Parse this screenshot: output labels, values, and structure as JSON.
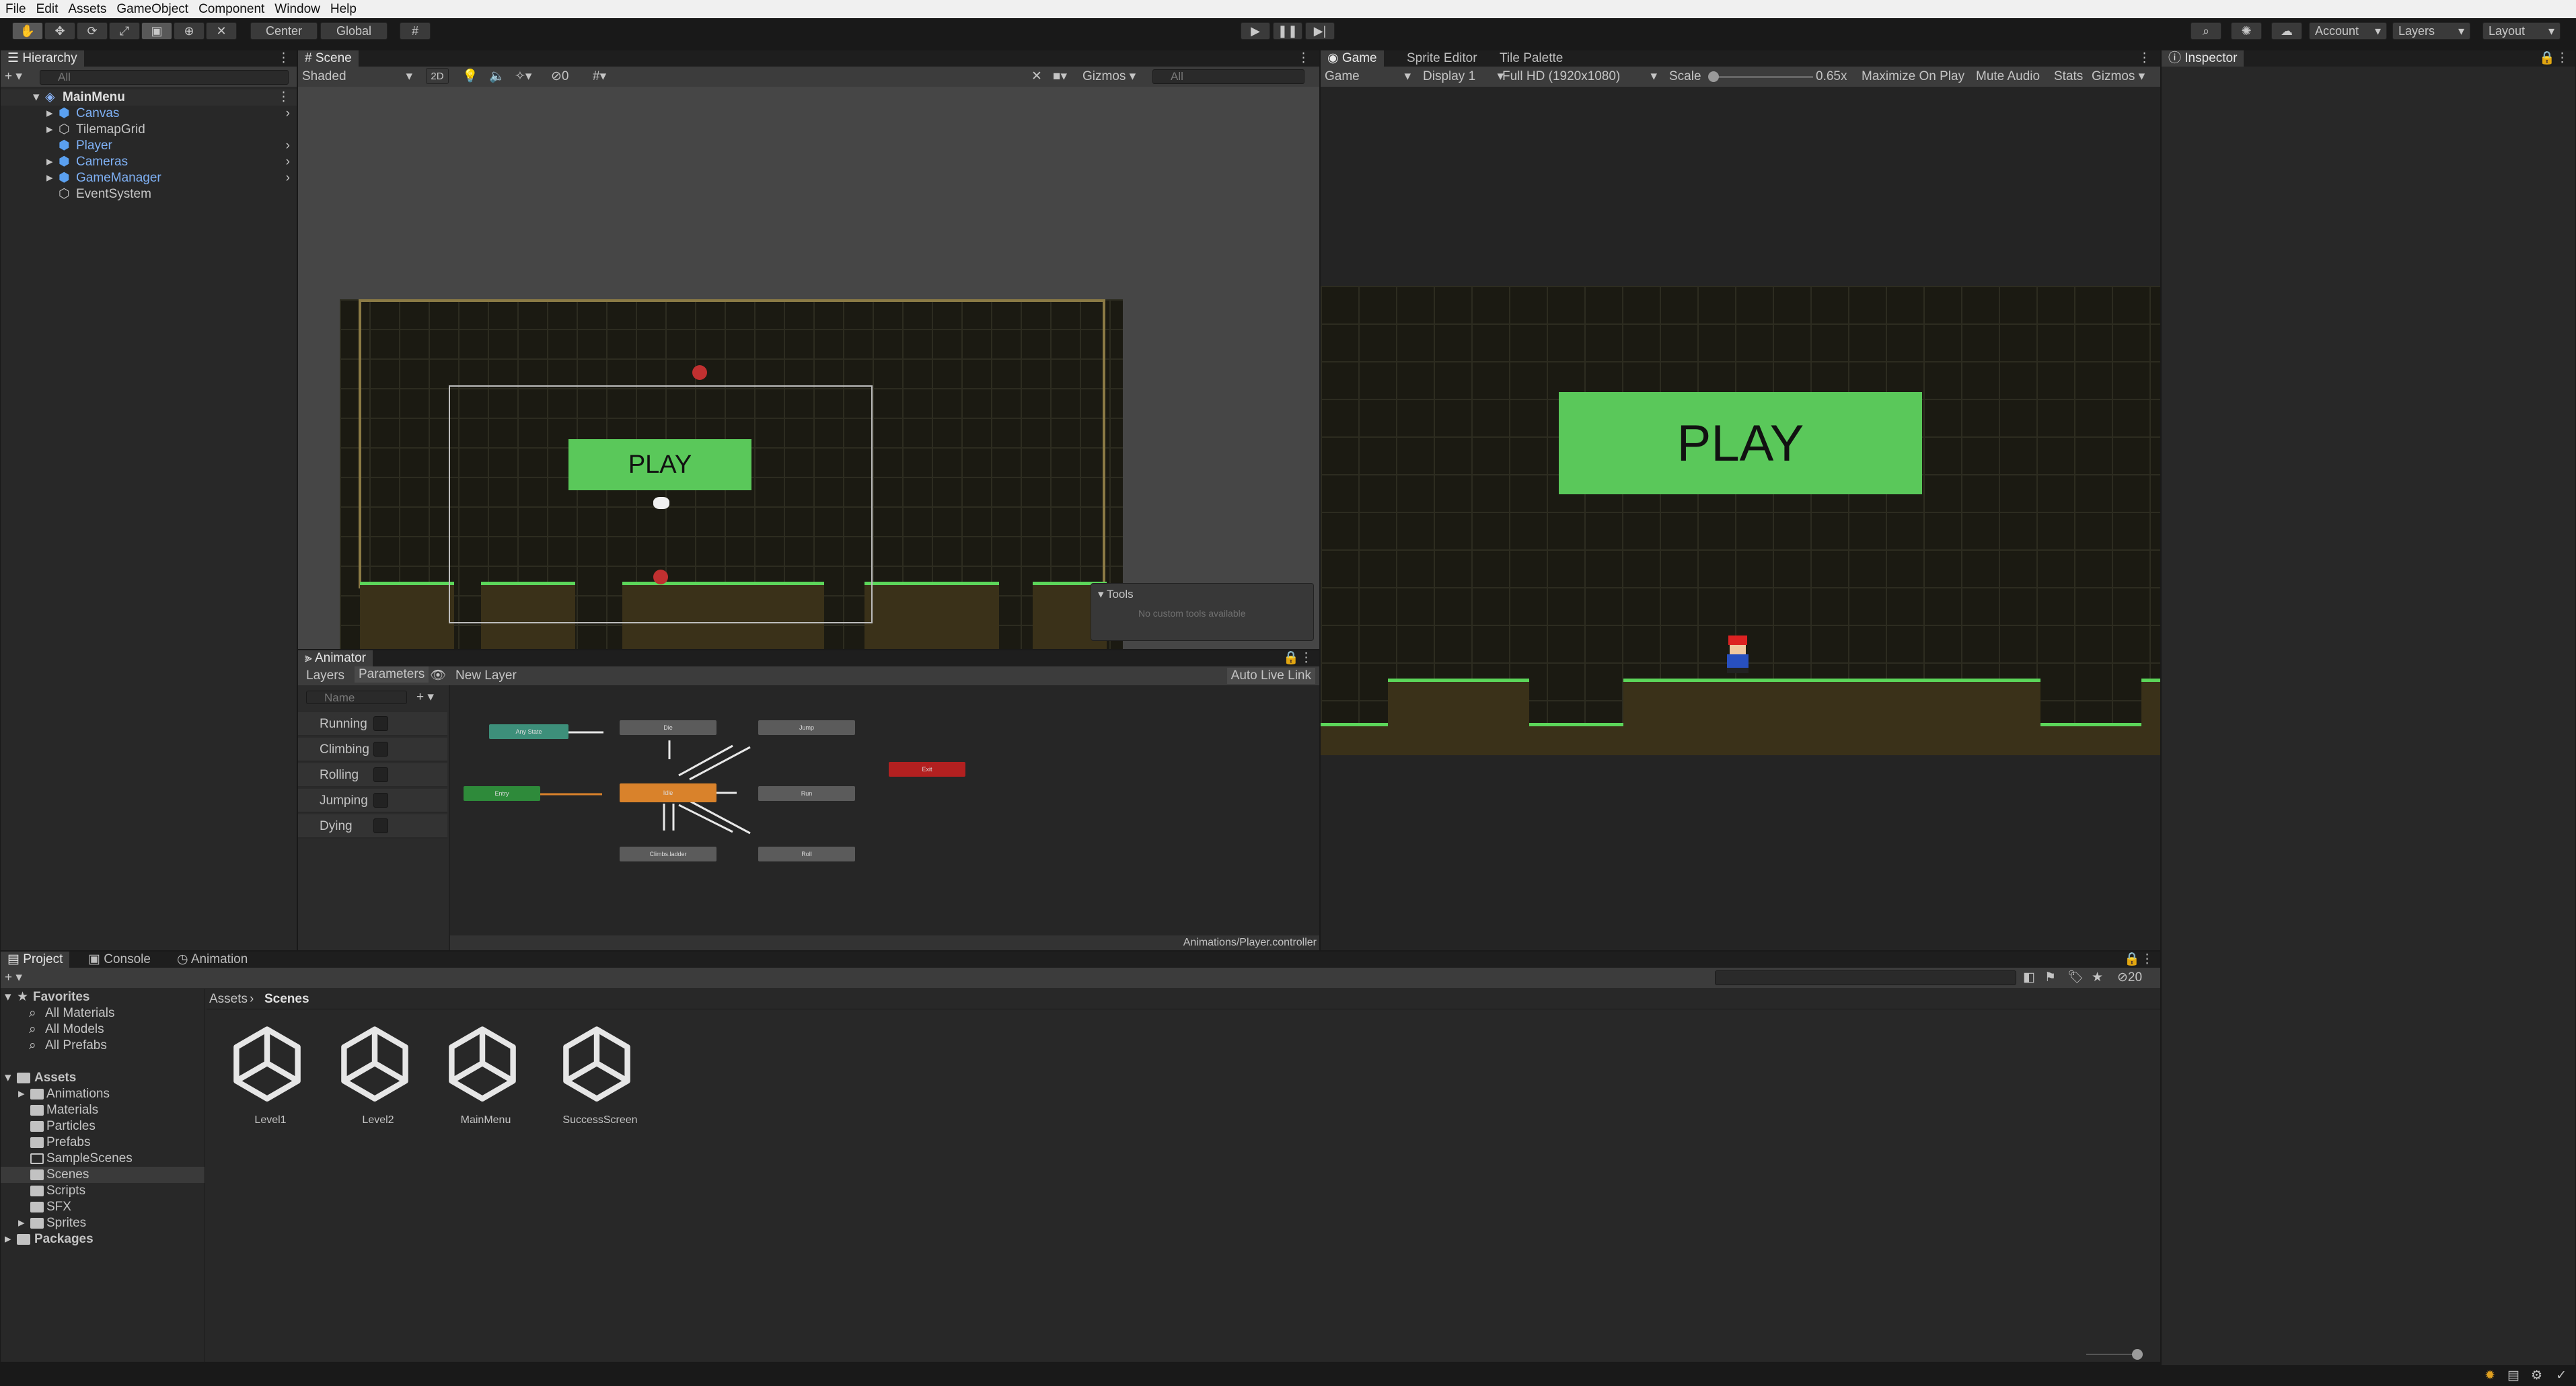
{
  "menu": [
    "File",
    "Edit",
    "Assets",
    "GameObject",
    "Component",
    "Window",
    "Help"
  ],
  "toolbar": {
    "pivot": "Center",
    "space": "Global",
    "account": "Account",
    "layers": "Layers",
    "layout": "Layout"
  },
  "hierarchy": {
    "tab": "Hierarchy",
    "search_placeholder": "All",
    "scene": "MainMenu",
    "items": [
      "Canvas",
      "TilemapGrid",
      "Player",
      "Cameras",
      "GameManager",
      "EventSystem"
    ]
  },
  "scene": {
    "tab": "Scene",
    "shading": "Shaded",
    "mode2d": "2D",
    "hidden_count": "0",
    "gizmos": "Gizmos",
    "search_placeholder": "All",
    "play_label": "PLAY",
    "tools_title": "Tools",
    "tools_text": "No custom tools available"
  },
  "game": {
    "tabs": [
      "Game",
      "Sprite Editor",
      "Tile Palette"
    ],
    "view": "Game",
    "display": "Display 1",
    "resolution": "Full HD (1920x1080)",
    "scale_label": "Scale",
    "scale_value": "0.65x",
    "maximize": "Maximize On Play",
    "mute": "Mute Audio",
    "stats": "Stats",
    "gizmos": "Gizmos",
    "play_label": "PLAY"
  },
  "inspector": {
    "tab": "Inspector"
  },
  "animator": {
    "tab": "Animator",
    "layers_tab": "Layers",
    "params_tab": "Parameters",
    "layer_name": "New Layer",
    "auto_live": "Auto Live Link",
    "search_placeholder": "Name",
    "params": [
      "Running",
      "Climbing",
      "Rolling",
      "Jumping",
      "Dying"
    ],
    "path": "Animations/Player.controller",
    "nodes": {
      "any": "Any State",
      "entry": "Entry",
      "exit": "Exit",
      "idle": "Idle",
      "jump": "Jump",
      "run": "Run",
      "roll": "Roll",
      "die": "Die",
      "climb": "Climbs.ladder"
    }
  },
  "project": {
    "tabs": [
      "Project",
      "Console",
      "Animation"
    ],
    "favorites": "Favorites",
    "fav_items": [
      "All Materials",
      "All Models",
      "All Prefabs"
    ],
    "assets": "Assets",
    "asset_folders": [
      "Animations",
      "Materials",
      "Particles",
      "Prefabs",
      "SampleScenes",
      "Scenes",
      "Scripts",
      "SFX",
      "Sprites"
    ],
    "packages": "Packages",
    "breadcrumb_root": "Assets",
    "breadcrumb_current": "Scenes",
    "files": [
      "Level1",
      "Level2",
      "MainMenu",
      "SuccessScreen"
    ],
    "hidden_count": "20"
  },
  "colors": {
    "accent": "#5ac85a",
    "selection": "#2c5d87",
    "bg": "#282828"
  }
}
